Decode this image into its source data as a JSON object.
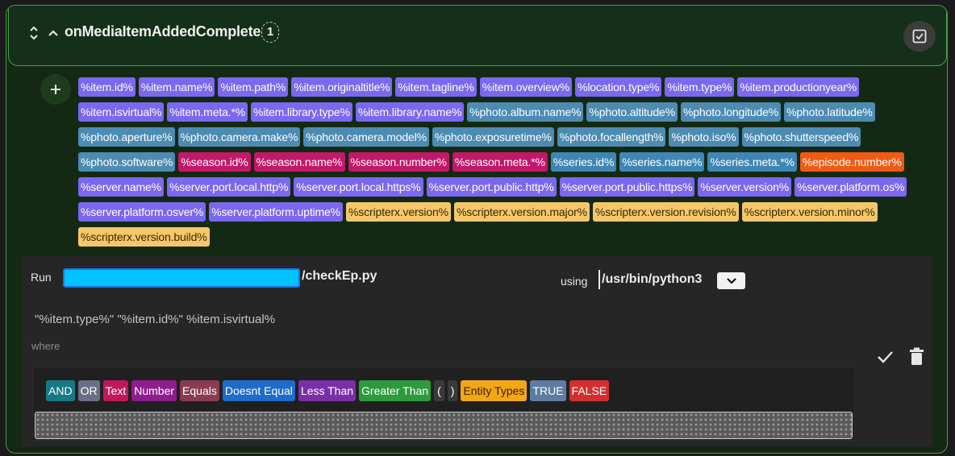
{
  "header": {
    "title": "onMediaItemAddedComplete",
    "badge": "1",
    "sort_icon": "sort-icon",
    "collapse_icon": "chevron-up-icon",
    "toggle_icon": "checkbox-checked-icon"
  },
  "add_button_icon": "plus-icon",
  "tag_groups": [
    {
      "group": "item",
      "color": "#7b68ee",
      "tags": [
        "%item.id%",
        "%item.name%",
        "%item.path%",
        "%item.originaltitle%",
        "%item.tagline%",
        "%item.overview%"
      ]
    }
  ],
  "tags": [
    {
      "label": "%item.id%",
      "kind": "item"
    },
    {
      "label": "%item.name%",
      "kind": "item"
    },
    {
      "label": "%item.path%",
      "kind": "item"
    },
    {
      "label": "%item.originaltitle%",
      "kind": "item"
    },
    {
      "label": "%item.tagline%",
      "kind": "item"
    },
    {
      "label": "%item.overview%",
      "kind": "item"
    },
    {
      "label": "%location.type%",
      "kind": "item"
    },
    {
      "label": "%item.type%",
      "kind": "item"
    },
    {
      "label": "%item.productionyear%",
      "kind": "item"
    },
    {
      "label": "%item.isvirtual%",
      "kind": "item"
    },
    {
      "label": "%item.meta.*%",
      "kind": "item"
    },
    {
      "label": "%item.library.type%",
      "kind": "lib"
    },
    {
      "label": "%item.library.name%",
      "kind": "lib"
    },
    {
      "label": "%photo.album.name%",
      "kind": "photo"
    },
    {
      "label": "%photo.altitude%",
      "kind": "photo"
    },
    {
      "label": "%photo.longitude%",
      "kind": "photo"
    },
    {
      "label": "%photo.latitude%",
      "kind": "photo"
    },
    {
      "label": "%photo.aperture%",
      "kind": "photo"
    },
    {
      "label": "%photo.camera.make%",
      "kind": "photo"
    },
    {
      "label": "%photo.camera.model%",
      "kind": "photo"
    },
    {
      "label": "%photo.exposuretime%",
      "kind": "photo"
    },
    {
      "label": "%photo.focallength%",
      "kind": "photo"
    },
    {
      "label": "%photo.iso%",
      "kind": "photo"
    },
    {
      "label": "%photo.shutterspeed%",
      "kind": "photo"
    },
    {
      "label": "%photo.software%",
      "kind": "photo"
    },
    {
      "label": "%season.id%",
      "kind": "season"
    },
    {
      "label": "%season.name%",
      "kind": "season"
    },
    {
      "label": "%season.number%",
      "kind": "season"
    },
    {
      "label": "%season.meta.*%",
      "kind": "season"
    },
    {
      "label": "%series.id%",
      "kind": "series"
    },
    {
      "label": "%series.name%",
      "kind": "series"
    },
    {
      "label": "%series.meta.*%",
      "kind": "series"
    },
    {
      "label": "%episode.number%",
      "kind": "episode"
    },
    {
      "label": "%server.name%",
      "kind": "server"
    },
    {
      "label": "%server.port.local.http%",
      "kind": "server"
    },
    {
      "label": "%server.port.local.https%",
      "kind": "server"
    },
    {
      "label": "%server.port.public.http%",
      "kind": "server"
    },
    {
      "label": "%server.port.public.https%",
      "kind": "server"
    },
    {
      "label": "%server.version%",
      "kind": "server"
    },
    {
      "label": "%server.platform.os%",
      "kind": "server"
    },
    {
      "label": "%server.platform.osver%",
      "kind": "server"
    },
    {
      "label": "%server.platform.uptime%",
      "kind": "server"
    },
    {
      "label": "%scripterx.version%",
      "kind": "scripterx"
    },
    {
      "label": "%scripterx.version.major%",
      "kind": "scripterx"
    },
    {
      "label": "%scripterx.version.revision%",
      "kind": "scripterx"
    },
    {
      "label": "%scripterx.version.minor%",
      "kind": "scripterx"
    },
    {
      "label": "%scripterx.version.build%",
      "kind": "scripterx"
    }
  ],
  "rule": {
    "run_label": "Run",
    "script_path_suffix": "/checkEp.py",
    "using_label": "using",
    "interpreter": "/usr/bin/python3",
    "arguments": "\"%item.type%\" \"%item.id%\" %item.isvirtual%",
    "where_label": "where",
    "confirm_icon": "check-icon",
    "delete_icon": "trash-icon",
    "operators": [
      "AND",
      "OR",
      "Text",
      "Number",
      "Equals",
      "Doesnt Equal",
      "Less Than",
      "Greater Than",
      "(",
      ")",
      "Entity Types",
      "TRUE",
      "FALSE"
    ]
  }
}
